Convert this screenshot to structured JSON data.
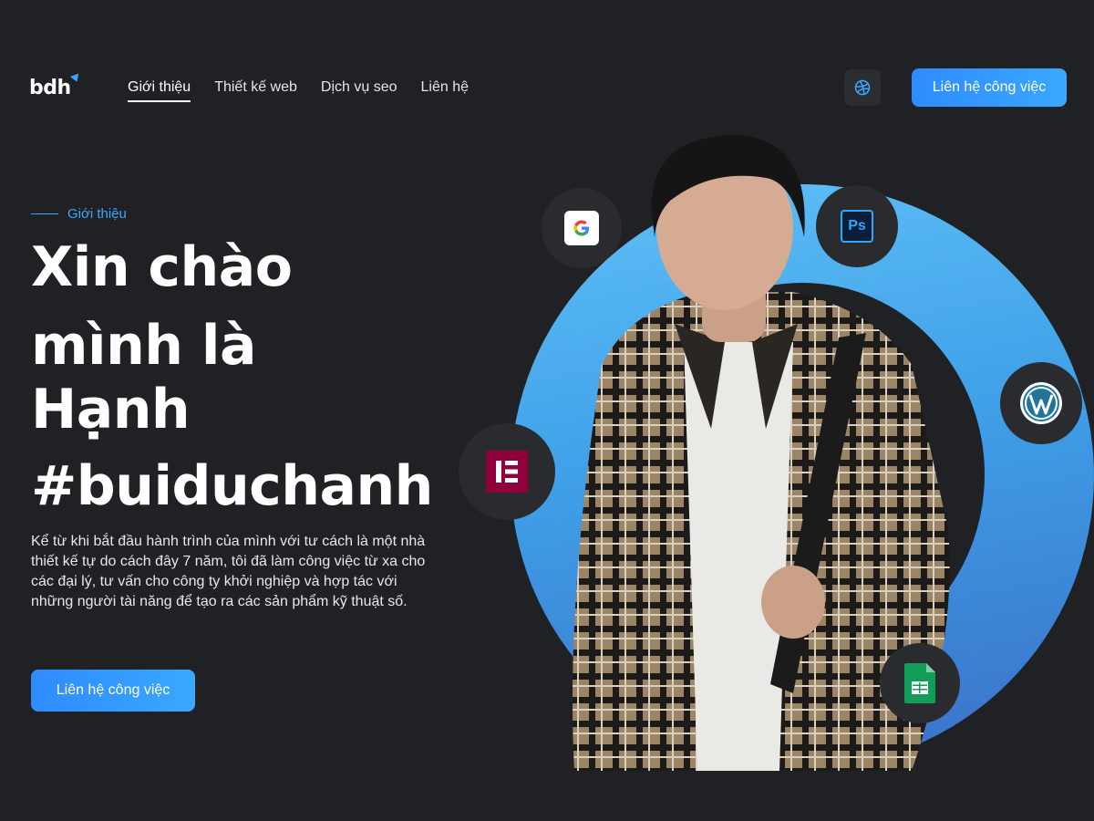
{
  "header": {
    "logo": "bdh",
    "nav": [
      {
        "label": "Giới thiệu",
        "active": true
      },
      {
        "label": "Thiết kế web",
        "active": false
      },
      {
        "label": "Dịch vụ seo",
        "active": false
      },
      {
        "label": "Liên hệ",
        "active": false
      }
    ],
    "theme_icon": "dribbble-icon",
    "cta_label": "Liên hệ công việc"
  },
  "hero": {
    "eyebrow": "Giới thiệu",
    "title_lines": [
      "Xin chào",
      "mình là",
      "Hạnh",
      "#buiduchanh"
    ],
    "description": "Kể từ khi bắt đầu hành trình của mình với tư cách là một nhà thiết kế tự do cách đây 7 năm, tôi đã làm công việc từ xa cho các đại lý, tư vấn cho công ty khởi nghiệp và hợp tác với những người tài năng để tạo ra các sản phẩm kỹ thuật số.",
    "cta_label": "Liên hệ công việc"
  },
  "visual": {
    "badges": [
      "google-icon",
      "photoshop-icon",
      "wordpress-icon",
      "elementor-icon",
      "google-sheets-icon"
    ],
    "photoshop_text": "Ps"
  },
  "colors": {
    "background": "#202124",
    "accent": "#3aa8ff",
    "ring_top": "#5fc0f7",
    "ring_bottom": "#3a6fc8"
  }
}
